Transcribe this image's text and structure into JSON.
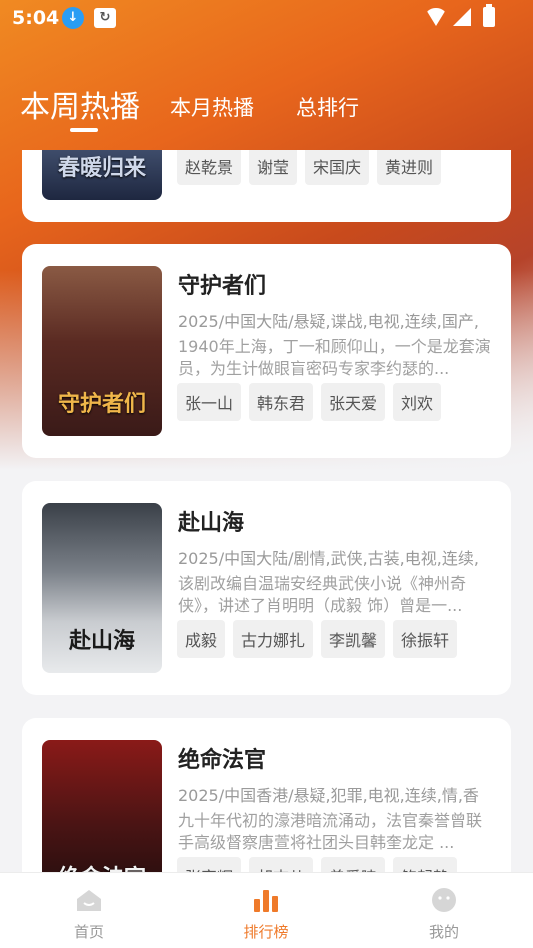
{
  "status_bar": {
    "time": "5:04"
  },
  "tabs": [
    {
      "label": "本周热播",
      "active": true
    },
    {
      "label": "本月热播",
      "active": false
    },
    {
      "label": "总排行",
      "active": false
    }
  ],
  "items": [
    {
      "poster_text": "春暖归来",
      "actors": [
        "赵乾景",
        "谢莹",
        "宋国庆",
        "黄进则"
      ]
    },
    {
      "title": "守护者们",
      "meta": "2025/中国大陆/悬疑,谍战,电视,连续,国产,",
      "desc": "1940年上海，丁一和顾仰山，一个是龙套演员，为生计做眼盲密码专家李约瑟的...",
      "poster_text": "守护者们",
      "actors": [
        "张一山",
        "韩东君",
        "张天爱",
        "刘欢"
      ]
    },
    {
      "title": "赴山海",
      "meta": "2025/中国大陆/剧情,武侠,古装,电视,连续,",
      "desc": "该剧改编自温瑞安经典武侠小说《神州奇侠》，讲述了肖明明（成毅 饰）曾是一...",
      "poster_text": "赴山海",
      "actors": [
        "成毅",
        "古力娜扎",
        "李凯馨",
        "徐振轩"
      ]
    },
    {
      "title": "绝命法官",
      "meta": "2025/中国香港/悬疑,犯罪,电视,连续,情,香",
      "desc": "九十年代初的濠港暗流涌动，法官秦誉曾联手高级督察唐萱将社团头目韩奎龙定 ...",
      "poster_text": "绝命法官",
      "actors": [
        "张家辉",
        "胡杏儿",
        "曾爱睐",
        "鲍起静"
      ]
    }
  ],
  "bottom_nav": [
    {
      "label": "首页",
      "icon": "home-icon",
      "active": false
    },
    {
      "label": "排行榜",
      "icon": "ranking-icon",
      "active": true
    },
    {
      "label": "我的",
      "icon": "profile-icon",
      "active": false
    }
  ],
  "colors": {
    "accent": "#ef7a2a",
    "header_top": "#f08a22"
  }
}
